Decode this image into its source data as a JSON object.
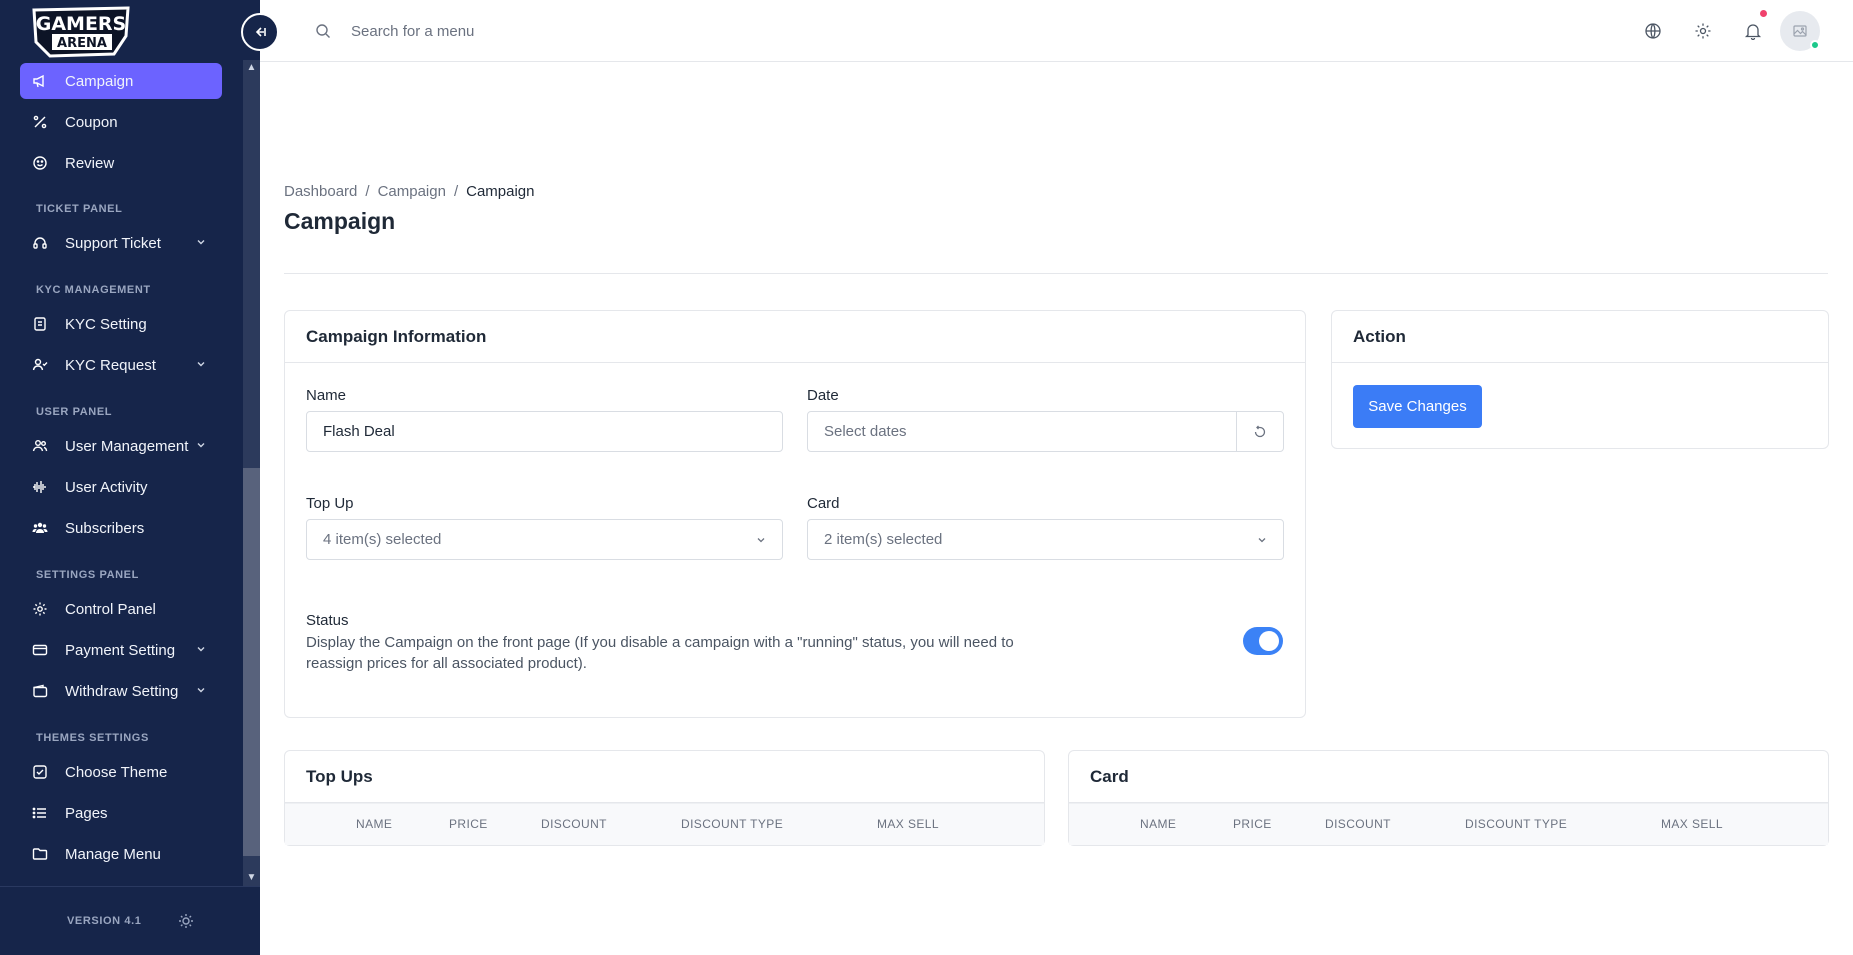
{
  "brand": {
    "logo_text_top": "GAMERS",
    "logo_text_bottom": "ARENA"
  },
  "sidebar": {
    "items": [
      {
        "label": "Campaign",
        "icon": "megaphone-icon",
        "active": true
      },
      {
        "label": "Coupon",
        "icon": "percent-icon"
      },
      {
        "label": "Review",
        "icon": "smile-icon"
      }
    ],
    "sections": [
      {
        "title": "TICKET PANEL",
        "items": [
          {
            "label": "Support Ticket",
            "icon": "headset-icon",
            "has_submenu": true
          }
        ]
      },
      {
        "title": "KYC MANAGEMENT",
        "items": [
          {
            "label": "KYC Setting",
            "icon": "document-icon"
          },
          {
            "label": "KYC Request",
            "icon": "user-check-icon",
            "has_submenu": true
          }
        ]
      },
      {
        "title": "USER PANEL",
        "items": [
          {
            "label": "User Management",
            "icon": "users-icon",
            "has_submenu": true
          },
          {
            "label": "User Activity",
            "icon": "activity-icon"
          },
          {
            "label": "Subscribers",
            "icon": "group-icon"
          }
        ]
      },
      {
        "title": "SETTINGS PANEL",
        "items": [
          {
            "label": "Control Panel",
            "icon": "gear-icon"
          },
          {
            "label": "Payment Setting",
            "icon": "credit-card-icon",
            "has_submenu": true
          },
          {
            "label": "Withdraw Setting",
            "icon": "wallet-icon",
            "has_submenu": true
          }
        ]
      },
      {
        "title": "THEMES SETTINGS",
        "items": [
          {
            "label": "Choose Theme",
            "icon": "check-square-icon"
          },
          {
            "label": "Pages",
            "icon": "list-icon"
          },
          {
            "label": "Manage Menu",
            "icon": "folder-icon"
          }
        ]
      }
    ],
    "version": "VERSION 4.1"
  },
  "topbar": {
    "search_placeholder": "Search for a menu"
  },
  "breadcrumb": {
    "items": [
      "Dashboard",
      "Campaign"
    ],
    "current": "Campaign"
  },
  "page_title": "Campaign",
  "campaign_info": {
    "title": "Campaign Information",
    "name_label": "Name",
    "name_value": "Flash Deal",
    "date_label": "Date",
    "date_placeholder": "Select dates",
    "topup_label": "Top Up",
    "topup_value": "4 item(s) selected",
    "card_label": "Card",
    "card_value": "2 item(s) selected",
    "status_label": "Status",
    "status_desc": "Display the Campaign on the front page (If you disable a campaign with a \"running\" status, you will need to reassign prices for all associated product).",
    "status_on": true
  },
  "action": {
    "title": "Action",
    "save_label": "Save Changes"
  },
  "topups_table": {
    "title": "Top Ups",
    "columns": [
      "NAME",
      "PRICE",
      "DISCOUNT",
      "DISCOUNT TYPE",
      "MAX SELL"
    ]
  },
  "card_table": {
    "title": "Card",
    "columns": [
      "NAME",
      "PRICE",
      "DISCOUNT",
      "DISCOUNT TYPE",
      "MAX SELL"
    ]
  },
  "colors": {
    "sidebar_bg": "#16254a",
    "active_item": "#6c63ff",
    "primary": "#3b7cf6",
    "notification": "#f0416c",
    "online": "#1cc88a"
  }
}
